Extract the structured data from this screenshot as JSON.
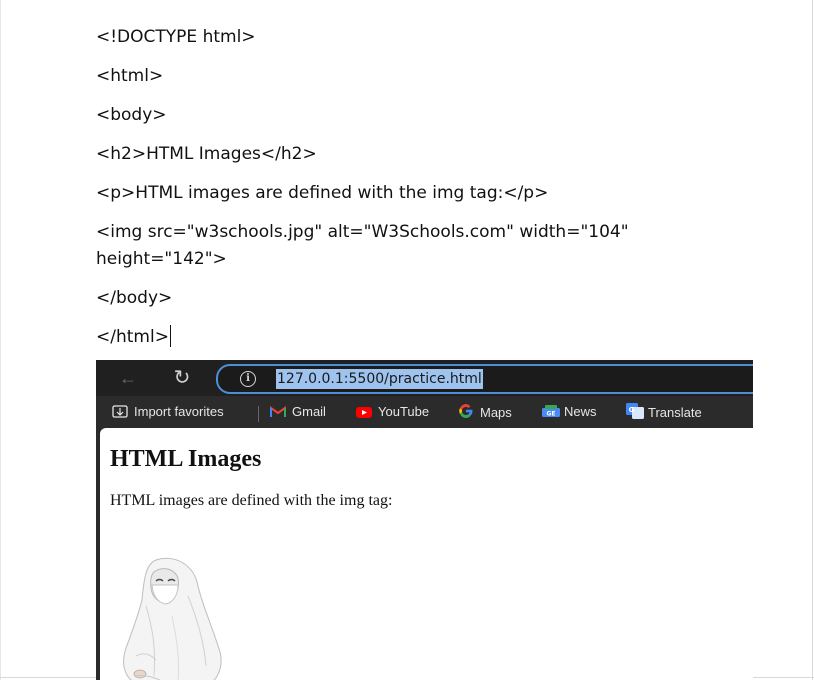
{
  "document": {
    "lines": [
      "<!DOCTYPE html>",
      "<html>",
      "<body>",
      "<h2>HTML Images</h2>",
      "<p>HTML images are defined with the img tag:</p>",
      "<img src=\"w3schools.jpg\" alt=\"W3Schools.com\" width=\"104\"",
      "height=\"142\">",
      "</body>",
      "</html>"
    ]
  },
  "browser": {
    "url": "127.0.0.1:5500/practice.html",
    "icons": {
      "back": "arrow-left-icon",
      "refresh": "refresh-icon",
      "info": "info-icon"
    },
    "bookmarks": [
      {
        "label": "Import favorites",
        "icon": "import-favorites-icon"
      },
      {
        "label": "Gmail",
        "icon": "gmail-icon",
        "color": "#ea4335"
      },
      {
        "label": "YouTube",
        "icon": "youtube-icon",
        "color": "#ff0000"
      },
      {
        "label": "Maps",
        "icon": "google-icon",
        "color": "#4285f4"
      },
      {
        "label": "News",
        "icon": "news-icon",
        "color": "#4a8af4"
      },
      {
        "label": "Translate",
        "icon": "translate-icon",
        "color": "#4285f4"
      }
    ],
    "page": {
      "heading": "HTML Images",
      "paragraph": "HTML images are defined with the img tag:"
    },
    "colors": {
      "toolbar": "#202020",
      "address_border": "#4f8fd6",
      "selection": "#9dc3ee"
    }
  }
}
